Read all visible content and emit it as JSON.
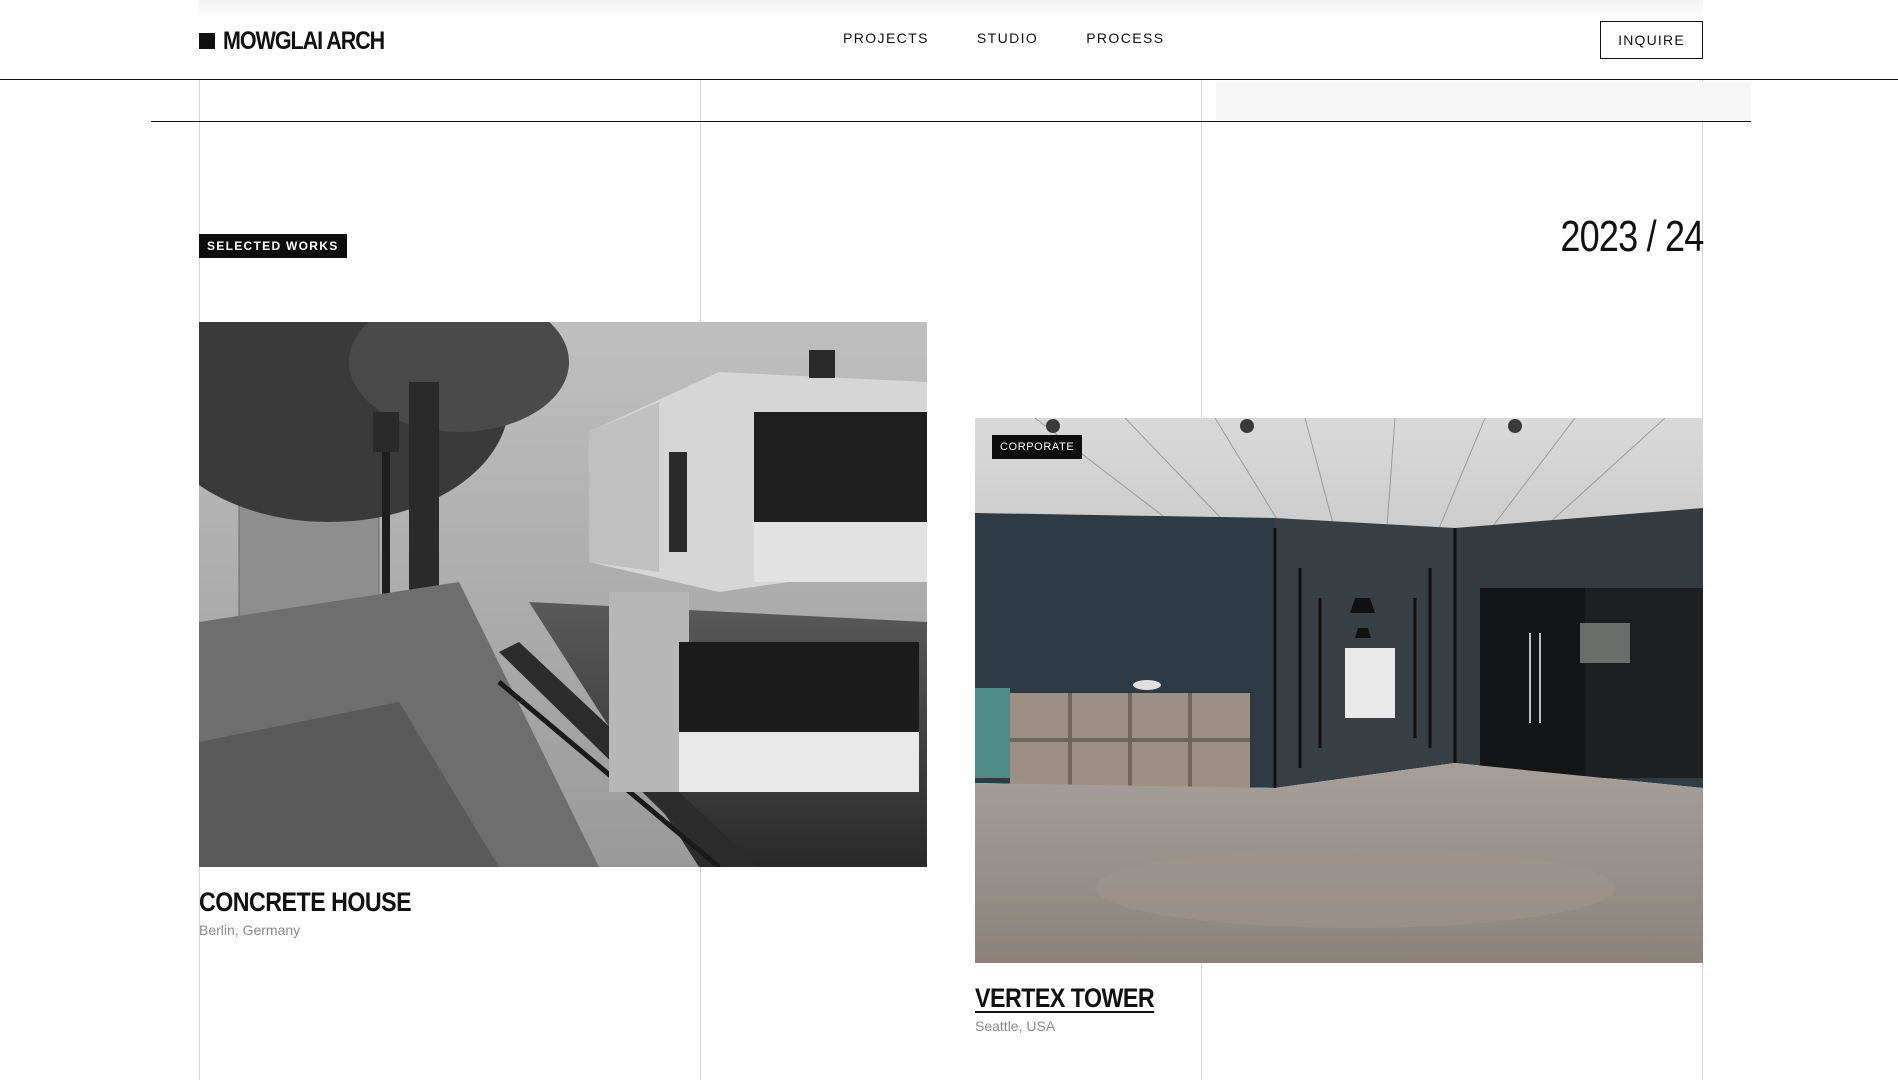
{
  "header": {
    "brand": "MOWGLAI ARCH",
    "nav": [
      "PROJECTS",
      "STUDIO",
      "PROCESS"
    ],
    "cta_label": "INQUIRE"
  },
  "section": {
    "tag": "SELECTED WORKS",
    "year": "2023 / 24"
  },
  "projects": [
    {
      "title": "CONCRETE HOUSE",
      "location": "Berlin, Germany",
      "badge": ""
    },
    {
      "title": "VERTEX TOWER",
      "location": "Seattle, USA",
      "badge": "CORPORATE"
    }
  ],
  "colors": {
    "ink": "#111111",
    "grid": "#d4d4d4",
    "muted": "#8a8a8a",
    "badge_bg": "#0d0d0d"
  }
}
